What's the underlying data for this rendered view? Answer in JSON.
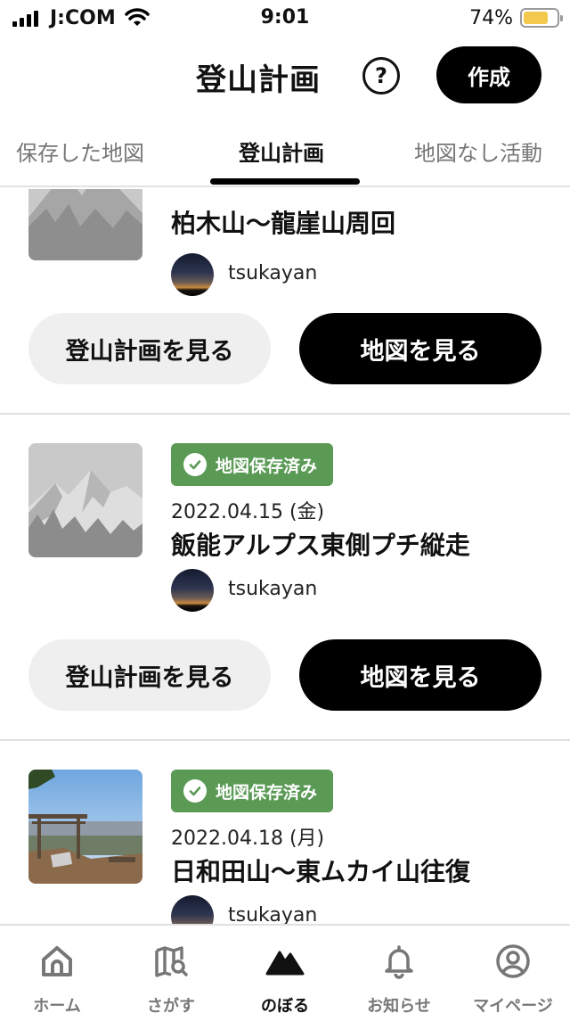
{
  "status_bar": {
    "carrier": "J:COM",
    "time": "9:01",
    "battery": "74%",
    "battery_level": 0.74,
    "battery_color": "#f2c94c"
  },
  "header": {
    "title": "登山計画",
    "help_icon": "help-circle-icon",
    "create_label": "作成"
  },
  "tabs": [
    {
      "label": "保存した地図",
      "active": false
    },
    {
      "label": "登山計画",
      "active": true
    },
    {
      "label": "地図なし活動",
      "active": false
    }
  ],
  "plans": [
    {
      "name": "柏木山〜龍崖山周回",
      "user": "tsukayan",
      "thumb": "mountain-placeholder",
      "plan_button": "登山計画を見る",
      "map_button": "地図を見る"
    },
    {
      "badge": "地図保存済み",
      "date": "2022.04.15 (金)",
      "name": "飯能アルプス東側プチ縦走",
      "user": "tsukayan",
      "thumb": "mountain-placeholder",
      "plan_button": "登山計画を見る",
      "map_button": "地図を見る"
    },
    {
      "badge": "地図保存済み",
      "date": "2022.04.18 (月)",
      "name": "日和田山〜東ムカイ山往復",
      "user": "tsukayan",
      "thumb": "photo-torii-view"
    }
  ],
  "bottom_nav": [
    {
      "label": "ホーム",
      "icon": "home-icon",
      "active": false
    },
    {
      "label": "さがす",
      "icon": "map-search-icon",
      "active": false
    },
    {
      "label": "のぼる",
      "icon": "climb-icon",
      "active": true
    },
    {
      "label": "お知らせ",
      "icon": "bell-icon",
      "active": false
    },
    {
      "label": "マイページ",
      "icon": "profile-icon",
      "active": false
    }
  ],
  "colors": {
    "badge_green": "#5a9a55",
    "primary": "#000000",
    "secondary_button": "#efefef"
  }
}
